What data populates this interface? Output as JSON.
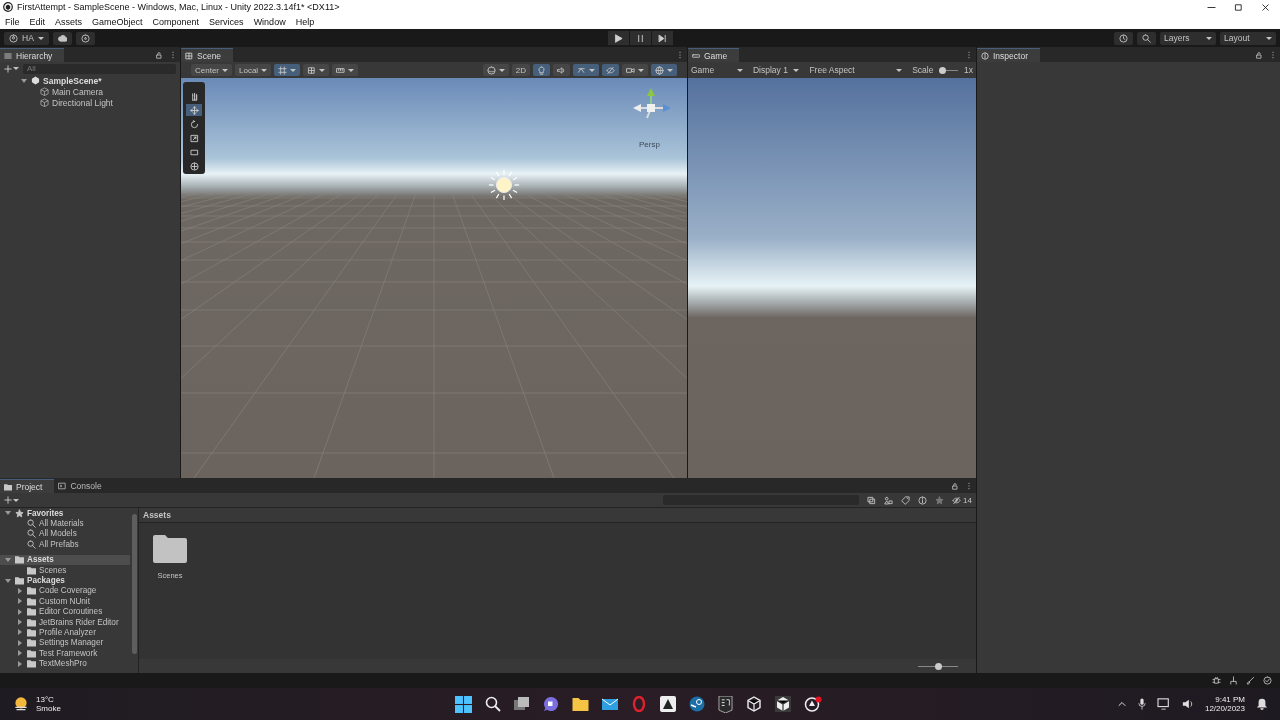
{
  "window": {
    "title": "FirstAttempt - SampleScene - Windows, Mac, Linux - Unity 2022.3.14f1* <DX11>"
  },
  "menu": [
    "File",
    "Edit",
    "Assets",
    "GameObject",
    "Component",
    "Services",
    "Window",
    "Help"
  ],
  "toolbar": {
    "account": "HA",
    "layers": "Layers",
    "layout": "Layout"
  },
  "hierarchy": {
    "title": "Hierarchy",
    "search_placeholder": "All",
    "scene": {
      "name": "SampleScene*",
      "expanded": true,
      "children": [
        {
          "name": "Main Camera"
        },
        {
          "name": "Directional Light"
        }
      ]
    }
  },
  "scene_view": {
    "title": "Scene",
    "pivot": "Center",
    "space": "Local",
    "mode_2d": "2D",
    "lighting_on": true,
    "projection": "Persp"
  },
  "game_view": {
    "title": "Game",
    "mode": "Game",
    "display": "Display 1",
    "aspect": "Free Aspect",
    "scale_label": "Scale",
    "scale_value": "1x",
    "level": 0
  },
  "inspector": {
    "title": "Inspector"
  },
  "project": {
    "tabs": [
      {
        "label": "Project",
        "selected": true
      },
      {
        "label": "Console",
        "selected": false
      }
    ],
    "tree": [
      {
        "label": "Favorites",
        "kind": "favorites",
        "expanded": true,
        "selected": false,
        "children": [
          {
            "label": "All Materials",
            "kind": "search",
            "selected": false
          },
          {
            "label": "All Models",
            "kind": "search",
            "selected": false
          },
          {
            "label": "All Prefabs",
            "kind": "search",
            "selected": false
          }
        ]
      },
      {
        "label": "Assets",
        "kind": "folder",
        "expanded": true,
        "selected": true,
        "children": [
          {
            "label": "Scenes",
            "kind": "folder",
            "selected": false
          }
        ]
      },
      {
        "label": "Packages",
        "kind": "folder",
        "expanded": true,
        "selected": false,
        "children": [
          {
            "label": "Code Coverage",
            "kind": "folder",
            "expanded": false,
            "selected": false
          },
          {
            "label": "Custom NUnit",
            "kind": "folder",
            "expanded": false,
            "selected": false
          },
          {
            "label": "Editor Coroutines",
            "kind": "folder",
            "expanded": false,
            "selected": false
          },
          {
            "label": "JetBrains Rider Editor",
            "kind": "folder",
            "expanded": false,
            "selected": false
          },
          {
            "label": "Profile Analyzer",
            "kind": "folder",
            "expanded": false,
            "selected": false
          },
          {
            "label": "Settings Manager",
            "kind": "folder",
            "expanded": false,
            "selected": false
          },
          {
            "label": "Test Framework",
            "kind": "folder",
            "expanded": false,
            "selected": false
          },
          {
            "label": "TextMeshPro",
            "kind": "folder",
            "expanded": false,
            "selected": false
          }
        ]
      }
    ],
    "breadcrumb": "Assets",
    "items": [
      {
        "label": "Scenes"
      }
    ],
    "hidden_count": "14",
    "level": 0.5
  },
  "taskbar": {
    "weather_temp": "13°C",
    "weather_desc": "Smoke",
    "time": "9:41 PM",
    "date": "12/20/2023"
  }
}
